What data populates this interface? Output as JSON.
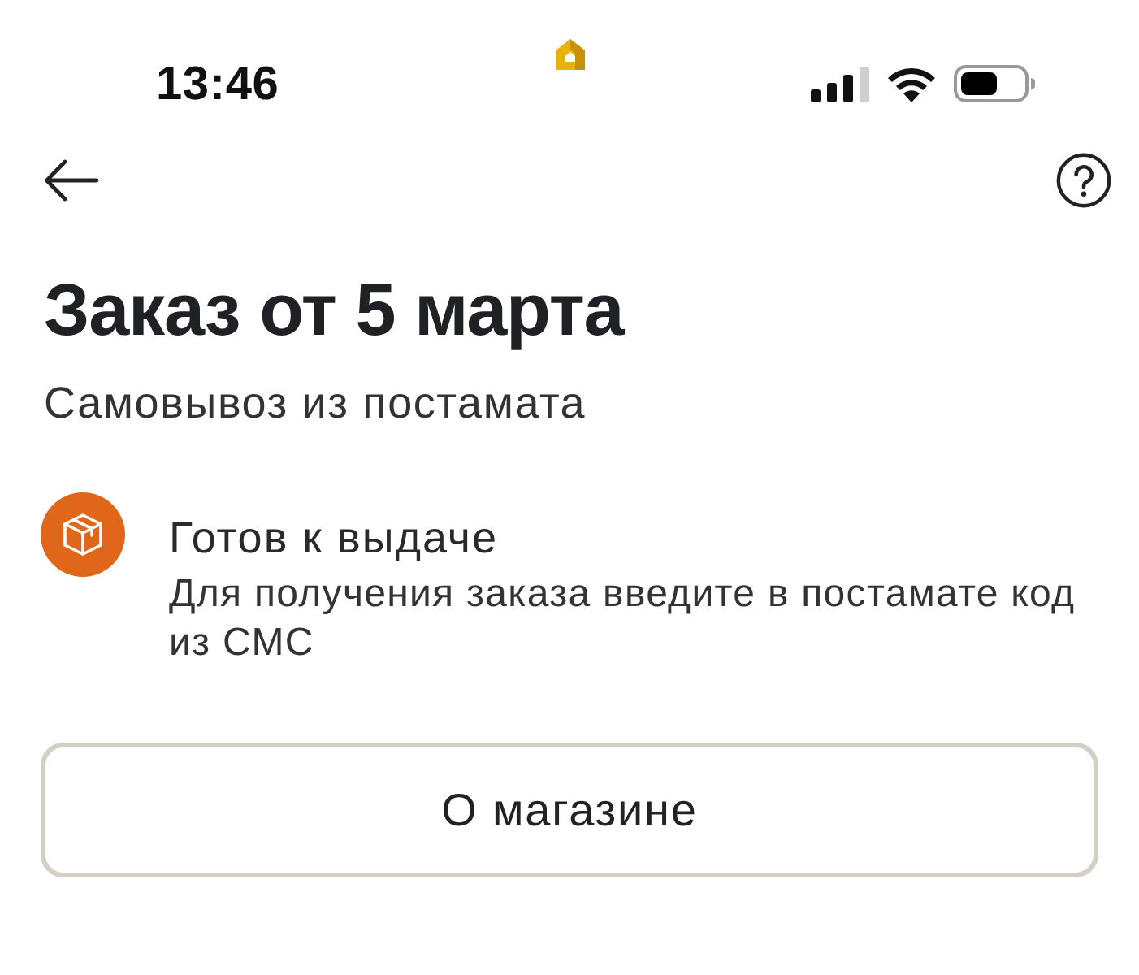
{
  "status_bar": {
    "time": "13:46"
  },
  "order": {
    "title": "Заказ от 5 марта",
    "delivery_method": "Самовывоз из постамата"
  },
  "status": {
    "title": "Готов к выдаче",
    "description": "Для получения заказа введите в постамате код из СМС"
  },
  "buttons": [
    {
      "label": "О магазине"
    }
  ]
}
